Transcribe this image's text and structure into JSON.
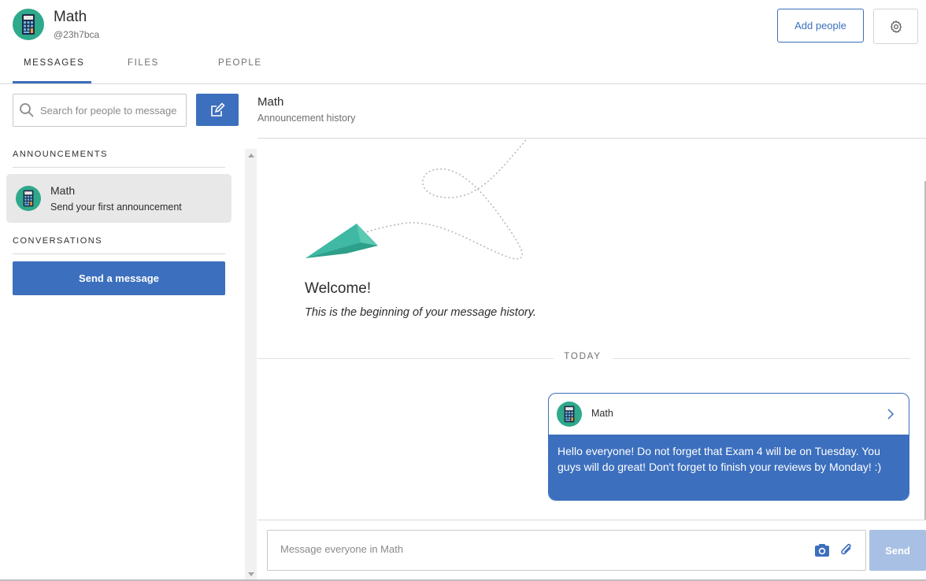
{
  "header": {
    "class_name": "Math",
    "class_code": "@23h7bca",
    "add_people_label": "Add people",
    "settings_icon": "gear-icon",
    "avatar_icon": "calculator-icon"
  },
  "tabs": [
    {
      "label": "MESSAGES",
      "active": true
    },
    {
      "label": "FILES",
      "active": false
    },
    {
      "label": "PEOPLE",
      "active": false
    }
  ],
  "sidebar": {
    "search_placeholder": "Search for people to message",
    "compose_icon": "edit-icon",
    "announcements_title": "ANNOUNCEMENTS",
    "announcement_item": {
      "name": "Math",
      "subtitle": "Send your first announcement"
    },
    "conversations_title": "CONVERSATIONS",
    "send_message_label": "Send a message"
  },
  "main": {
    "title": "Math",
    "subtitle": "Announcement history",
    "welcome_title": "Welcome!",
    "welcome_sub": "This is the beginning of your message history.",
    "today_label": "TODAY",
    "message": {
      "author": "Math",
      "text": "Hello everyone! Do not forget that Exam 4 will be on Tuesday. You guys will do great! Don't forget to finish your reviews by Monday! :)"
    },
    "composer": {
      "placeholder": "Message everyone in Math",
      "send_label": "Send"
    }
  },
  "colors": {
    "accent": "#3c6fbd",
    "avatar_bg": "#2fa98b",
    "send_disabled": "#a8c0e3",
    "plane": "#3fb9a3"
  }
}
